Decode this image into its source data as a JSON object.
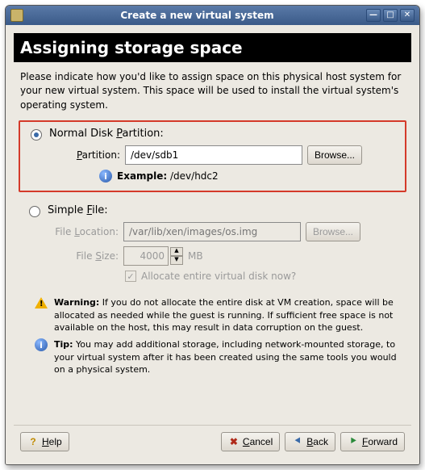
{
  "window": {
    "title": "Create a new virtual system"
  },
  "heading": "Assigning storage space",
  "intro": "Please indicate how you'd like to assign space on this physical host system for your new virtual system. This space will be used to install the virtual system's operating system.",
  "option_partition": {
    "label": "Normal Disk Partition:",
    "field_label": "Partition:",
    "value": "/dev/sdb1",
    "browse": "Browse...",
    "example_label": "Example:",
    "example_value": "/dev/hdc2"
  },
  "option_file": {
    "label": "Simple File:",
    "field_label": "File Location:",
    "placeholder": "/var/lib/xen/images/os.img",
    "browse": "Browse...",
    "size_label": "File Size:",
    "size_value": "4000",
    "size_unit": "MB",
    "allocate_label": "Allocate entire virtual disk now?"
  },
  "warning": {
    "title": "Warning:",
    "text": "If you do not allocate the entire disk at VM creation, space will be allocated as needed while the guest is running. If sufficient free space is not available on the host, this may result in data corruption on the guest."
  },
  "tip": {
    "title": "Tip:",
    "text": "You may add additional storage, including network-mounted storage, to your virtual system after it has been created using the same tools you would on a physical system."
  },
  "buttons": {
    "help": "Help",
    "cancel": "Cancel",
    "back": "Back",
    "forward": "Forward"
  }
}
